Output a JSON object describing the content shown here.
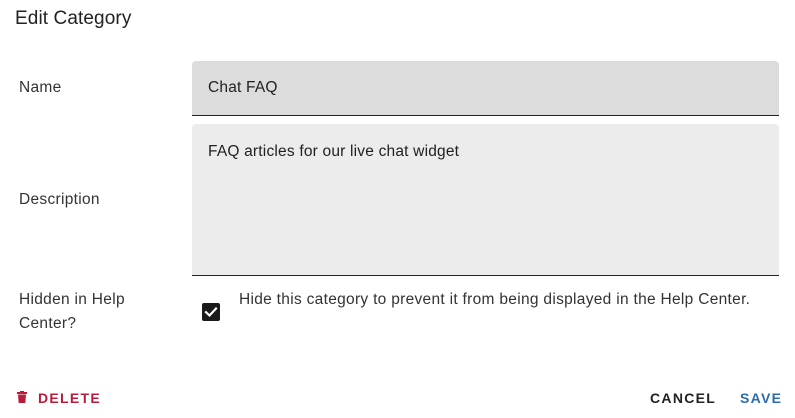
{
  "dialog": {
    "title": "Edit Category"
  },
  "form": {
    "name_label": "Name",
    "name_value": "Chat FAQ",
    "description_label": "Description",
    "description_value": "FAQ articles for our live chat widget",
    "hidden_label_line1": "Hidden in Help",
    "hidden_label_line2": "Center?",
    "hidden_checked": true,
    "hidden_help_text": "Hide this category to prevent it from being displayed in the Help Center."
  },
  "actions": {
    "delete_label": "DELETE",
    "delete_icon": "trash-icon",
    "cancel_label": "CANCEL",
    "save_label": "SAVE"
  },
  "colors": {
    "delete": "#b71c3a",
    "save": "#2b6cb0",
    "checkbox": "#1a1a1a"
  }
}
